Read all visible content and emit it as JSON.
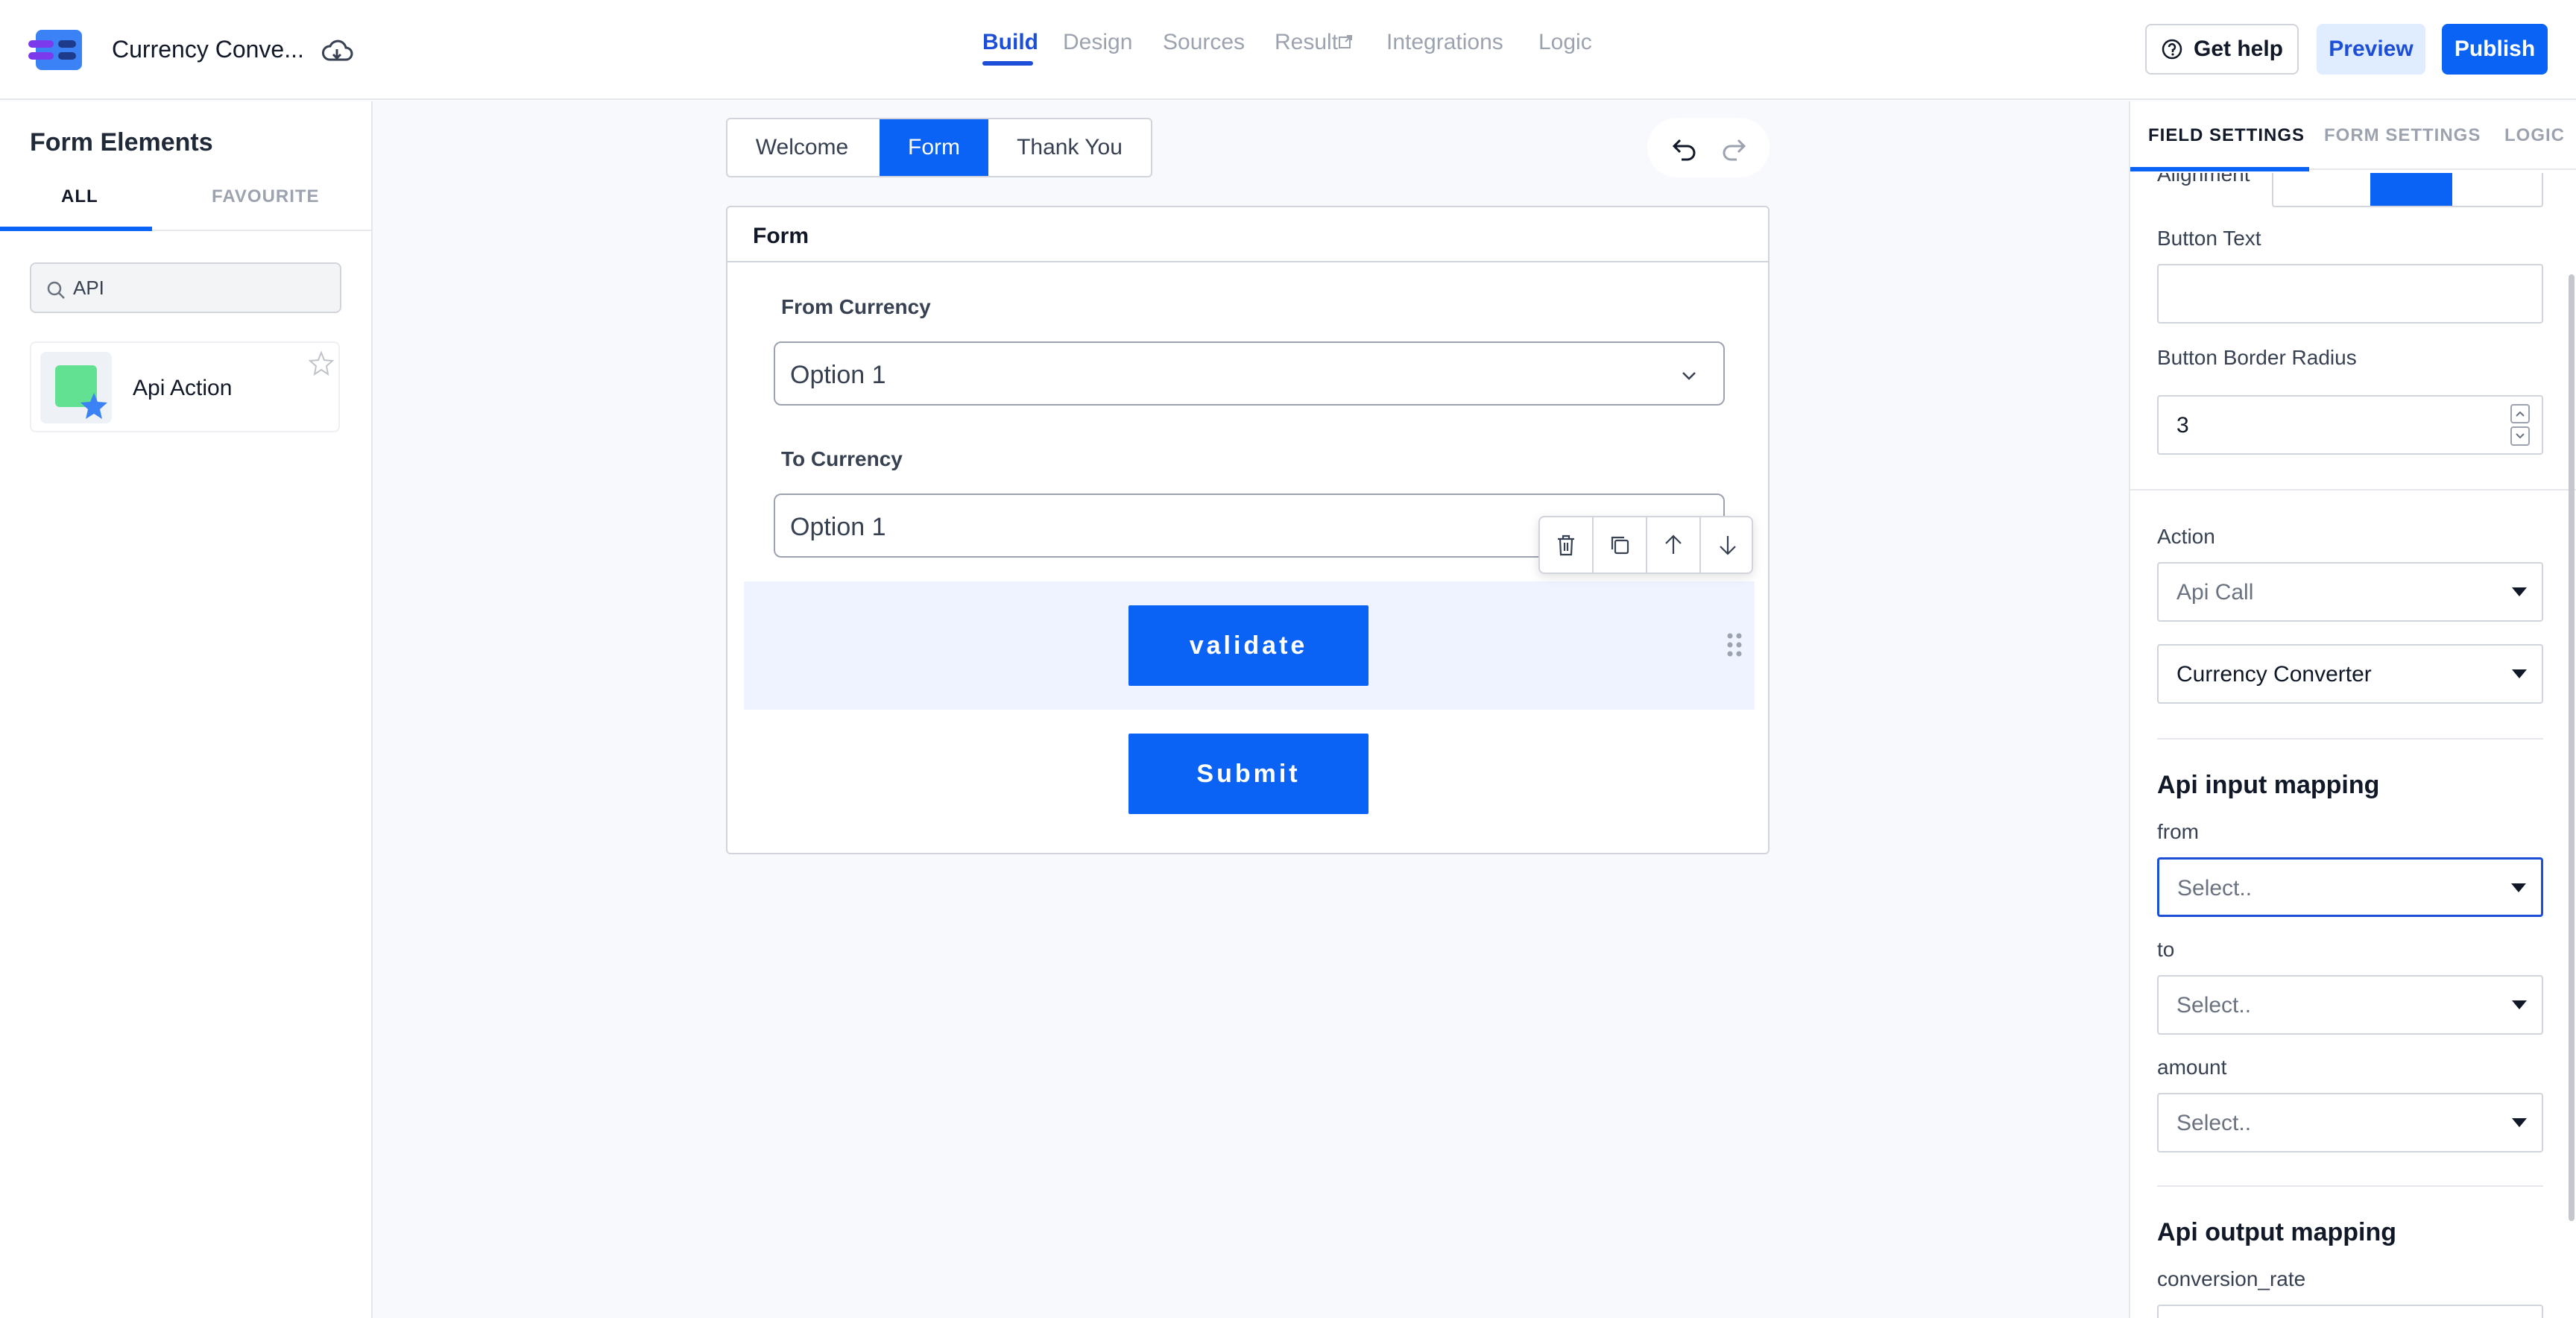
{
  "app": {
    "title": "Currency Conve..."
  },
  "nav": {
    "items": [
      {
        "label": "Build",
        "active": true
      },
      {
        "label": "Design"
      },
      {
        "label": "Sources"
      },
      {
        "label": "Result"
      },
      {
        "label": "Integrations"
      },
      {
        "label": "Logic"
      }
    ]
  },
  "header_actions": {
    "help": "Get help",
    "preview": "Preview",
    "publish": "Publish"
  },
  "left_panel": {
    "title": "Form Elements",
    "tabs": [
      "ALL",
      "FAVOURITE"
    ],
    "search_value": "API",
    "elements": [
      {
        "label": "Api Action"
      }
    ]
  },
  "canvas": {
    "page_tabs": [
      "Welcome",
      "Form",
      "Thank You"
    ],
    "active_page": "Form",
    "form_title": "Form",
    "fields": [
      {
        "label": "From Currency",
        "value": "Option 1"
      },
      {
        "label": "To Currency",
        "value": "Option 1"
      }
    ],
    "buttons": [
      "validate",
      "Submit"
    ]
  },
  "right_panel": {
    "tabs": [
      "FIELD SETTINGS",
      "FORM SETTINGS",
      "LOGIC"
    ],
    "alignment_label": "Alignment",
    "button_text_label": "Button Text",
    "button_text_value": "",
    "border_radius_label": "Button Border Radius",
    "border_radius_value": "3",
    "action_label": "Action",
    "action_value": "Api Call",
    "api_value": "Currency Converter",
    "input_mapping_heading": "Api input mapping",
    "input_mappings": [
      {
        "label": "from",
        "value": "Select.."
      },
      {
        "label": "to",
        "value": "Select.."
      },
      {
        "label": "amount",
        "value": "Select.."
      }
    ],
    "output_mapping_heading": "Api output mapping",
    "output_mappings": [
      {
        "label": "conversion_rate"
      }
    ]
  },
  "colors": {
    "primary": "#0b63f6",
    "primary_dark": "#1d4ed8",
    "preview_bg": "#e0ecff",
    "selected_row": "#eef3ff"
  }
}
